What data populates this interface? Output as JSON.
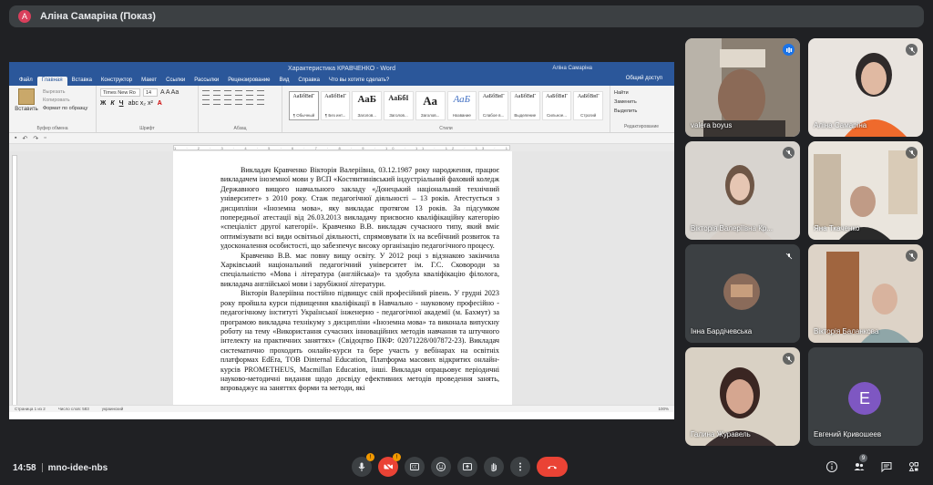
{
  "header": {
    "avatar_letter": "A",
    "title": "Аліна Самаріна (Показ)"
  },
  "word": {
    "window_title": "Характеристика КРАВЧЕНКО  -  Word",
    "user": "Аліна Самаріна",
    "tabs": [
      "Файл",
      "Главная",
      "Вставка",
      "Конструктор",
      "Макет",
      "Ссылки",
      "Рассылки",
      "Рецензирование",
      "Вид",
      "Справка"
    ],
    "tell_me": "Что вы хотите сделать?",
    "share": "Общий доступ",
    "clipboard": {
      "paste": "Вставить",
      "cut": "Вырезать",
      "copy": "Копировать",
      "format_painter": "Формат по образцу",
      "group": "Буфер обмена"
    },
    "font": {
      "name": "Times New Ro",
      "size": "14",
      "group": "Шрифт",
      "bold": "Ж",
      "italic": "К",
      "underline": "Ч"
    },
    "paragraph_group": "Абзац",
    "styles": [
      {
        "preview": "АаБбВвГ",
        "name": "¶ Обычный"
      },
      {
        "preview": "АаБбВвГ",
        "name": "¶ Без инт..."
      },
      {
        "preview": "АаБ",
        "name": "Заголов..."
      },
      {
        "preview": "АаБбI",
        "name": "Заголов..."
      },
      {
        "preview": "Аа",
        "name": "Заголов..."
      },
      {
        "preview": "АаБ",
        "name": "Название"
      },
      {
        "preview": "АаБбВвГ",
        "name": "Слабое в..."
      },
      {
        "preview": "АаБбВвГ",
        "name": "Выделение"
      },
      {
        "preview": "АаБбВвГ",
        "name": "Сильное..."
      },
      {
        "preview": "АаБбВвГ",
        "name": "Строгий"
      }
    ],
    "styles_group": "Стили",
    "editing": {
      "find": "Найти",
      "replace": "Заменить",
      "select": "Выделить",
      "group": "Редактирование"
    },
    "ruler_marks": "1 · 2 · 3 · 4 · 5 · 6 · 7 · 8 · 9 · 10 · 11 · 12 · 13 · 14 · 15 · 16 · 17",
    "paragraphs": [
      "Викладач Кравченко Вікторія Валеріївна, 03.12.1987 року народження, працює викладачем іноземної мови у ВСП «Костянтинівський індустріальний фаховий коледж Державного вищого навчального закладу «Донецький національний технічний університет» з 2010 року. Стаж педагогічної діяльності – 13 років. Атестується з дисципліни «Іноземна мова», яку викладає протягом 13 років. За підсумком попередньої атестації від 26.03.2013 викладачу присвоєно кваліфікаційну категорію «спеціаліст другої категорії». Кравченко В.В. викладач сучасного типу, який вміє оптимізувати всі види освітньої діяльності, спрямовувати їх на всебічний розвиток та удосконалення особистості, що забезпечує високу організацію педагогічного процесу.",
      "Кравченко В.В. має повну вищу освіту. У 2012 році з відзнакою закінчила Харківський національний педагогічний університет ім. Г.С. Сковороди за спеціальністю «Мова і література (англійська)» та здобула кваліфікацію філолога, викладача англійської мови і зарубіжної літератури.",
      "Вікторія Валеріївна постійно підвищує свій професійний рівень. У грудні 2023 року пройшла курси підвищення кваліфікації в Навчально - науковому професійно - педагогічному інституті Української інженерно - педагогічної академії (м. Бахмут) за програмою викладача технікуму з дисципліни «Іноземна мова» та виконала випускну роботу на тему «Використання сучасних інноваційних методів навчання та штучного інтелекту на практичних заняттях» (Свідоцтво ПКФ: 02071228/007872-23). Викладач систематично проходить онлайн-курси та бере участь у вебінарах на освітніх платформах EdEra, ТОВ Dinternal Education, Платформа масових відкритих онлайн-курсів PROMETHEUS, Macmillan Education, інші. Викладач опрацьовує періодичні науково-методичні видання щодо досвіду ефективних методів проведення занять, впроваджує на заняттях форми та методи, які"
    ],
    "status": {
      "page": "Страница 1 из 2",
      "words": "Число слов: 583",
      "lang": "украинский",
      "zoom": "100%"
    }
  },
  "participants": [
    {
      "name": "valera boyus",
      "speaking": true
    },
    {
      "name": "Аліна Самаріна",
      "muted": true
    },
    {
      "name": "Вікторія Валеріївна Кр...",
      "muted": true
    },
    {
      "name": "Яна Ткаченко",
      "muted": true
    },
    {
      "name": "Інна Бардічевська",
      "muted": true
    },
    {
      "name": "Вікторія Баланкова",
      "muted": true
    },
    {
      "name": "Галина Журавель",
      "muted": true
    },
    {
      "name": "Евгений Кривошеев",
      "avatar": "E",
      "avatar_color": "#7e57c2"
    }
  ],
  "bottom": {
    "time": "14:58",
    "meeting_code": "mno-idee-nbs",
    "mic_badge": "!",
    "cam_badge": "!",
    "people_count": "9"
  }
}
